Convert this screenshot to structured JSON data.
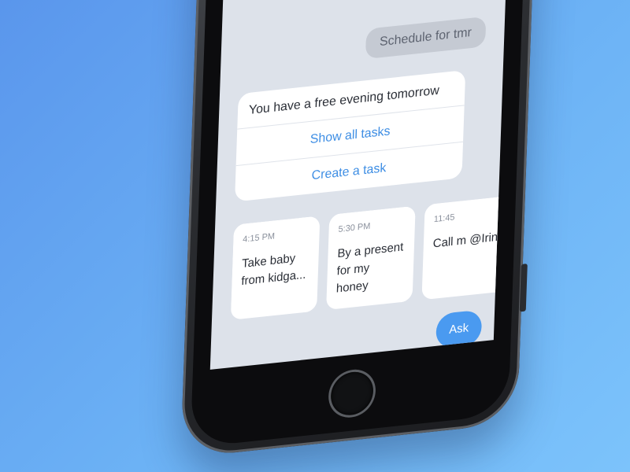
{
  "chat": {
    "sent_message": "Schedule for tmr",
    "reply_text": "You have a free evening tomorrow",
    "actions": [
      {
        "label": "Show all tasks"
      },
      {
        "label": "Create a task"
      }
    ]
  },
  "tasks": [
    {
      "time": "4:15 PM",
      "title": "Take baby from kidga..."
    },
    {
      "time": "5:30 PM",
      "title": "By a present for my honey"
    },
    {
      "time": "11:45",
      "title": "Call m @Irin"
    }
  ],
  "composer": {
    "ask_label": "Ask"
  },
  "colors": {
    "background": "#6cb2f5",
    "accent": "#3e8ee4",
    "ask_button": "#4a9af0",
    "screen_bg": "#dde2ea"
  },
  "icons": [
    "home-button-icon"
  ]
}
